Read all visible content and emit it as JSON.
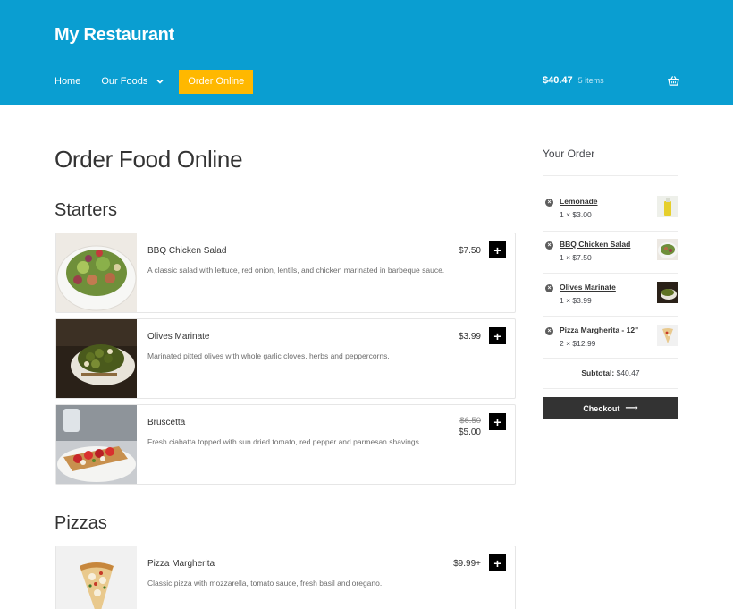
{
  "site": {
    "title": "My Restaurant"
  },
  "nav": {
    "home": "Home",
    "foods": "Our Foods",
    "order": "Order Online"
  },
  "cart": {
    "total": "$40.47",
    "count": "5 items",
    "icon": "basket-icon"
  },
  "page": {
    "title": "Order Food Online"
  },
  "sections": {
    "starters": "Starters",
    "pizzas": "Pizzas"
  },
  "menu": {
    "bbq": {
      "name": "BBQ Chicken Salad",
      "price": "$7.50",
      "desc": "A classic salad with lettuce, red onion, lentils, and chicken marinated in barbeque sauce."
    },
    "olives": {
      "name": "Olives Marinate",
      "price": "$3.99",
      "desc": "Marinated pitted olives with whole garlic cloves, herbs and peppercorns."
    },
    "bruscetta": {
      "name": "Bruscetta",
      "price_old": "$6.50",
      "price": "$5.00",
      "desc": "Fresh ciabatta topped with sun dried tomato, red pepper and parmesan shavings."
    },
    "pizza": {
      "name": "Pizza Margherita",
      "price": "$9.99+",
      "desc": "Classic pizza with mozzarella, tomato sauce, fresh basil and oregano."
    },
    "add_label": "+"
  },
  "order": {
    "title": "Your Order",
    "lines": [
      {
        "name": "Lemonade",
        "qty": "1 × $3.00"
      },
      {
        "name": "BBQ Chicken Salad",
        "qty": "1 × $7.50"
      },
      {
        "name": "Olives Marinate",
        "qty": "1 × $3.99"
      },
      {
        "name": "Pizza Margherita - 12\"",
        "qty": "2 × $12.99"
      }
    ],
    "subtotal_label": "Subtotal:",
    "subtotal_value": "$40.47",
    "checkout": "Checkout",
    "checkout_arrow": "⟶",
    "remove_symbol": "×"
  },
  "colors": {
    "header": "#0a9ed1",
    "accent": "#ffb800",
    "checkout": "#333333"
  }
}
